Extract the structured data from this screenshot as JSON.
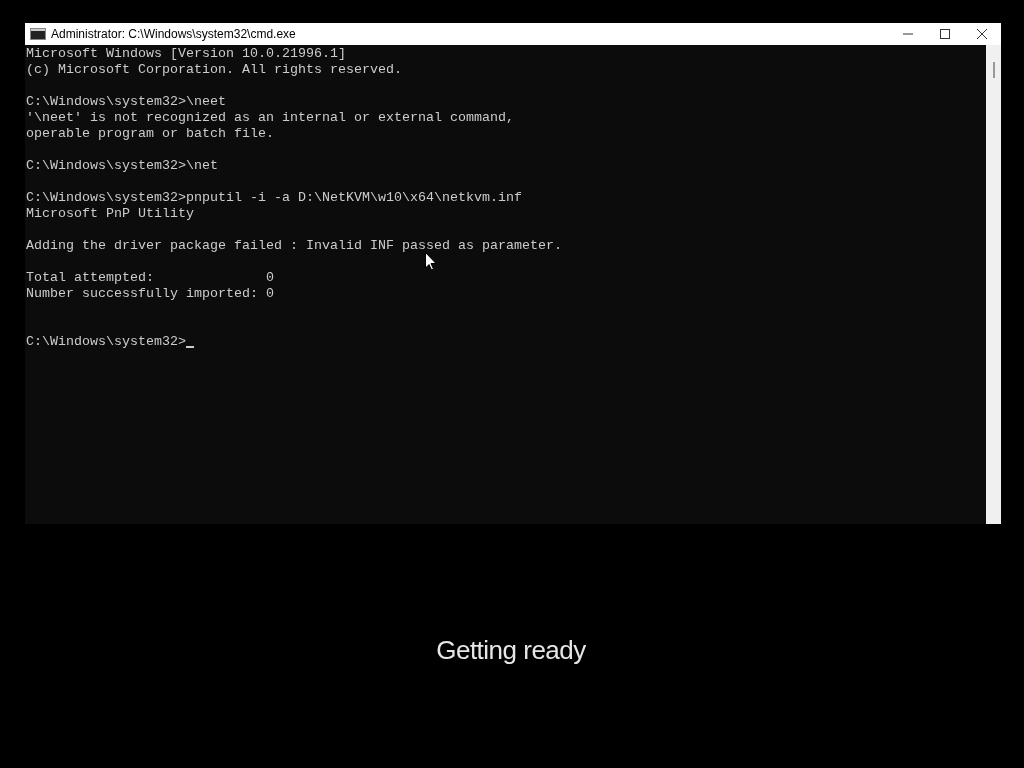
{
  "window": {
    "title": "Administrator: C:\\Windows\\system32\\cmd.exe"
  },
  "console": {
    "lines": [
      {
        "kind": "text",
        "text": "Microsoft Windows [Version 10.0.21996.1]"
      },
      {
        "kind": "text",
        "text": "(c) Microsoft Corporation. All rights reserved."
      },
      {
        "kind": "blank"
      },
      {
        "kind": "text",
        "text": "C:\\Windows\\system32>\\neet"
      },
      {
        "kind": "text",
        "text": "'\\neet' is not recognized as an internal or external command,"
      },
      {
        "kind": "text",
        "text": "operable program or batch file."
      },
      {
        "kind": "blank"
      },
      {
        "kind": "text",
        "text": "C:\\Windows\\system32>\\net"
      },
      {
        "kind": "blank"
      },
      {
        "kind": "text",
        "text": "C:\\Windows\\system32>pnputil -i -a D:\\NetKVM\\w10\\x64\\netkvm.inf"
      },
      {
        "kind": "text",
        "text": "Microsoft PnP Utility"
      },
      {
        "kind": "blank"
      },
      {
        "kind": "text",
        "text": "Adding the driver package failed : Invalid INF passed as parameter."
      },
      {
        "kind": "blank"
      },
      {
        "kind": "text",
        "text": "Total attempted:              0"
      },
      {
        "kind": "text",
        "text": "Number successfully imported: 0"
      },
      {
        "kind": "blank"
      },
      {
        "kind": "blank"
      },
      {
        "kind": "prompt",
        "text": "C:\\Windows\\system32>"
      }
    ]
  },
  "status_message": "Getting ready"
}
